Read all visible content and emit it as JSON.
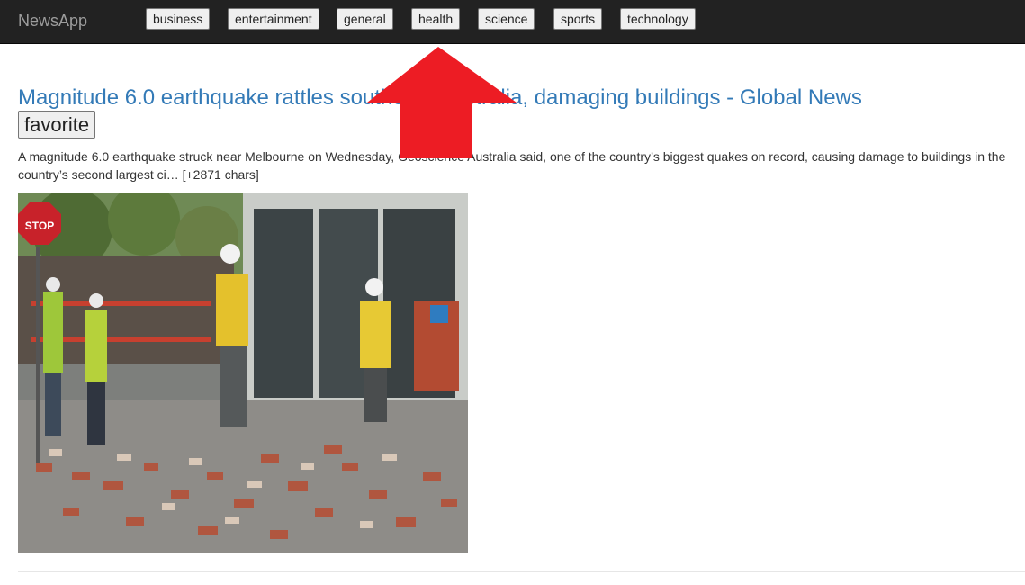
{
  "navbar": {
    "brand": "NewsApp",
    "categories": [
      "business",
      "entertainment",
      "general",
      "health",
      "science",
      "sports",
      "technology"
    ]
  },
  "article": {
    "title": "Magnitude 6.0 earthquake rattles southeast Australia, damaging buildings - Global News",
    "favorite_label": "favorite",
    "description": "A magnitude 6.0 earthquake struck near Melbourne on Wednesday, Geoscience Australia said, one of the country’s biggest quakes on record, causing damage to buildings in the country’s second largest ci… [+2871 chars]",
    "image_sign_text": "STOP"
  },
  "annotation": {
    "arrow_color": "#ed1c24",
    "points_to": "health"
  },
  "colors": {
    "navbar_bg": "#222222",
    "brand_text": "#9d9d9d",
    "link": "#337ab7"
  }
}
